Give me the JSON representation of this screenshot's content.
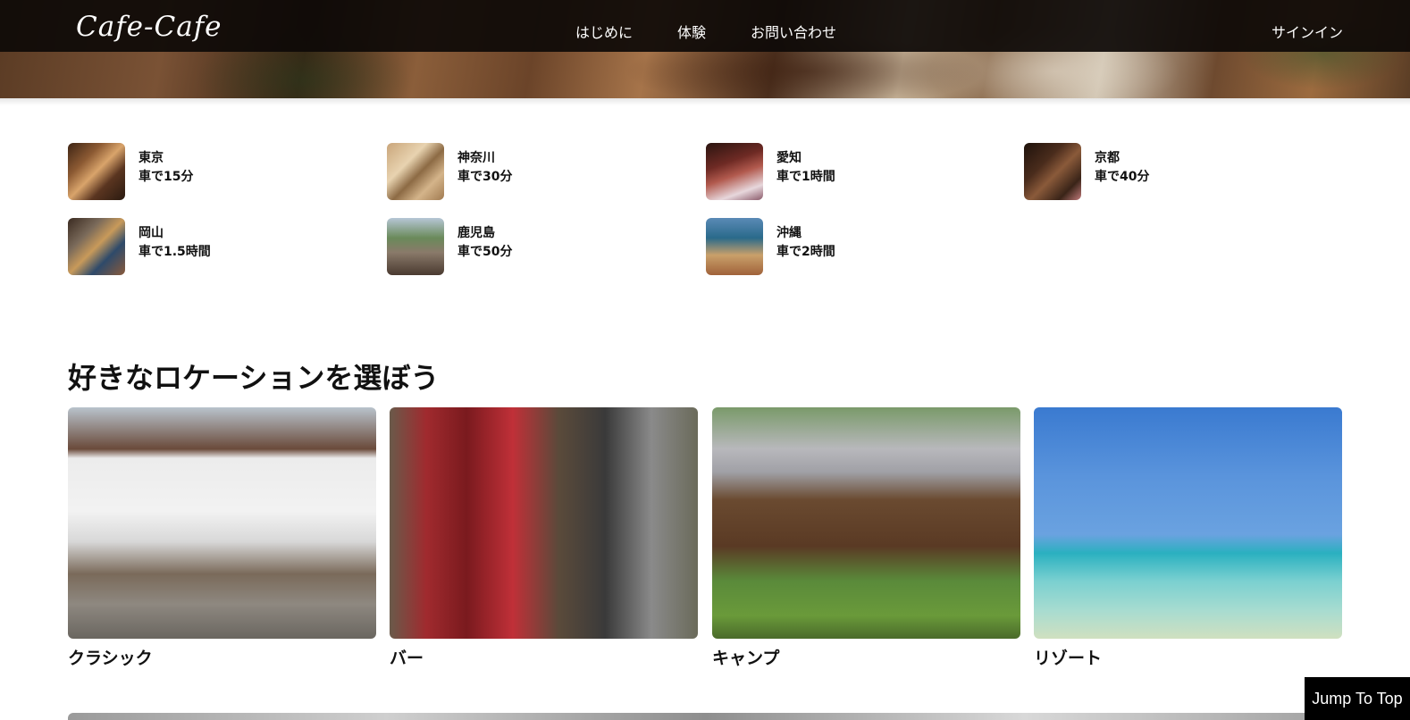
{
  "header": {
    "logo": "Cafe-Cafe",
    "nav": [
      "はじめに",
      "体験",
      "お問い合わせ"
    ],
    "signin": "サインイン"
  },
  "locations": [
    {
      "name": "東京",
      "time": "車で15分"
    },
    {
      "name": "神奈川",
      "time": "車で30分"
    },
    {
      "name": "愛知",
      "time": "車で1時間"
    },
    {
      "name": "京都",
      "time": "車で40分"
    },
    {
      "name": "岡山",
      "time": "車で1.5時間"
    },
    {
      "name": "鹿児島",
      "time": "車で50分"
    },
    {
      "name": "沖縄",
      "time": "車で2時間"
    }
  ],
  "section": {
    "title": "好きなロケーションを選ぼう"
  },
  "categories": [
    {
      "label": "クラシック"
    },
    {
      "label": "バー"
    },
    {
      "label": "キャンプ"
    },
    {
      "label": "リゾート"
    }
  ],
  "jump_to_top": "Jump To Top"
}
